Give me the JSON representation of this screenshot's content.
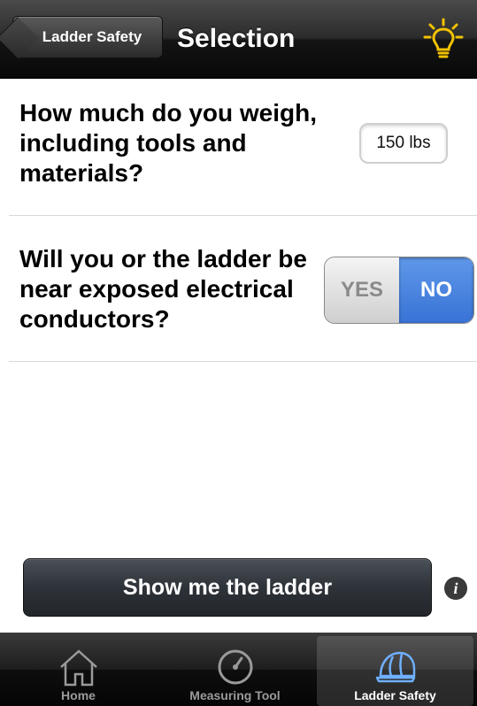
{
  "navbar": {
    "back_label": "Ladder Safety",
    "title": "Selection"
  },
  "questions": {
    "weight": {
      "label": "How much do you weigh, including tools and materials?",
      "value": "150 lbs"
    },
    "electrical": {
      "label": "Will you or the ladder be near exposed electrical conductors?",
      "yes_label": "YES",
      "no_label": "NO",
      "selected": "NO"
    }
  },
  "actions": {
    "show_ladder_label": "Show me the ladder"
  },
  "tabbar": {
    "items": [
      {
        "label": "Home",
        "icon": "home-icon"
      },
      {
        "label": "Measuring Tool",
        "icon": "gauge-icon"
      },
      {
        "label": "Ladder Safety",
        "icon": "hard-hat-icon",
        "active": true
      }
    ]
  },
  "colors": {
    "accent_blue": "#3873d6",
    "bulb_yellow": "#f2c200"
  }
}
